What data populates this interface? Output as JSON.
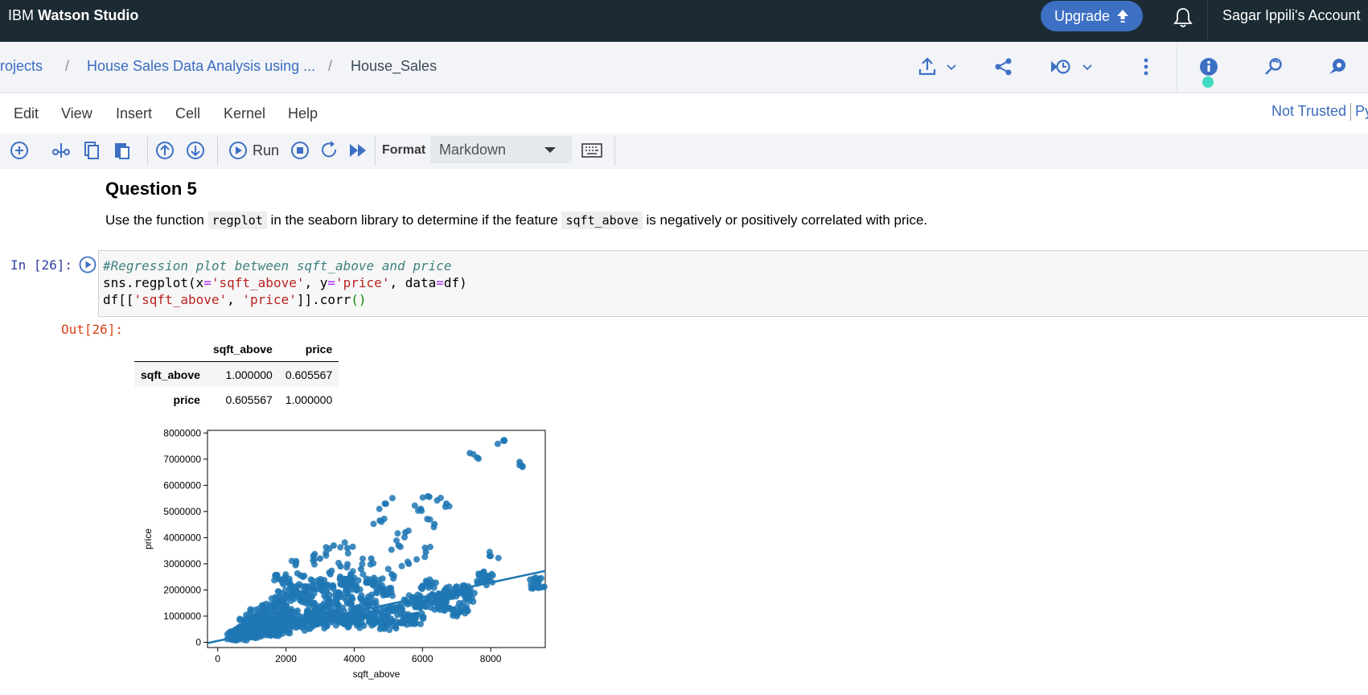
{
  "header": {
    "brand_prefix": "IBM",
    "brand_name": "Watson Studio",
    "upgrade_label": "Upgrade",
    "account_label": "Sagar Ippili's Account"
  },
  "breadcrumb": {
    "projects": "rojects",
    "project": "House Sales Data Analysis using ...",
    "notebook": "House_Sales",
    "separator": "/"
  },
  "menu": {
    "items": [
      "Edit",
      "View",
      "Insert",
      "Cell",
      "Kernel",
      "Help"
    ],
    "trusted": "Not Trusted",
    "kernel_partial": "Py"
  },
  "toolbar": {
    "run_label": "Run",
    "format_label": "Format",
    "format_value": "Markdown"
  },
  "markdown_cell": {
    "title": "Question 5",
    "text_before": "Use the function",
    "code1": "regplot",
    "text_middle": "in the seaborn library to determine if the feature",
    "code2": "sqft_above",
    "text_after": "is negatively or positively correlated with price."
  },
  "code_cell": {
    "prompt": "In [26]:",
    "comment": "#Regression plot between sqft_above and price",
    "line2_a": "sns.regplot(x",
    "line2_b": "'sqft_above'",
    "line2_c": ", y",
    "line2_d": "'price'",
    "line2_e": ", data",
    "line2_f": "df)",
    "line3_a": "df[[",
    "line3_b": "'sqft_above'",
    "line3_c": ", ",
    "line3_d": "'price'",
    "line3_e": "]].corr",
    "line3_f": "()",
    "eq": "="
  },
  "output": {
    "prompt": "Out[26]:",
    "table": {
      "columns": [
        "sqft_above",
        "price"
      ],
      "rows": [
        {
          "index": "sqft_above",
          "values": [
            "1.000000",
            "0.605567"
          ]
        },
        {
          "index": "price",
          "values": [
            "0.605567",
            "1.000000"
          ]
        }
      ]
    }
  },
  "chart_data": {
    "type": "scatter",
    "xlabel": "sqft_above",
    "ylabel": "price",
    "xlim": [
      -300,
      9600
    ],
    "ylim": [
      -200000,
      8100000
    ],
    "xticks": [
      0,
      2000,
      4000,
      6000,
      8000
    ],
    "yticks": [
      0,
      1000000,
      2000000,
      3000000,
      4000000,
      5000000,
      6000000,
      7000000,
      8000000
    ],
    "ytick_labels": [
      "0",
      "1000000",
      "2000000",
      "3000000",
      "4000000",
      "5000000",
      "6000000",
      "7000000",
      "8000000"
    ],
    "color": "#1f77b4",
    "points": [
      [
        8400,
        7700000
      ],
      [
        7600,
        7060000
      ],
      [
        8850,
        6890000
      ],
      [
        4900,
        5300000
      ],
      [
        6200,
        5560000
      ],
      [
        6700,
        5300000
      ],
      [
        5950,
        5100000
      ],
      [
        6350,
        4520000
      ],
      [
        4750,
        4650000
      ],
      [
        5500,
        4200000
      ],
      [
        8000,
        3300000
      ],
      [
        7800,
        2700000
      ],
      [
        7850,
        2400000
      ],
      [
        9400,
        2280000
      ],
      [
        7200,
        1950000
      ],
      [
        6800,
        1900000
      ],
      [
        6500,
        1700000
      ],
      [
        7100,
        1150000
      ],
      [
        5300,
        3700000
      ],
      [
        6100,
        3450000
      ],
      [
        3400,
        3700000
      ],
      [
        3800,
        3600000
      ],
      [
        2300,
        3100000
      ],
      [
        2800,
        3300000
      ],
      [
        4500,
        3200000
      ],
      [
        5600,
        3000000
      ],
      [
        3000,
        3200000
      ],
      [
        4200,
        2800000
      ],
      [
        5100,
        2600000
      ],
      [
        6200,
        2200000
      ],
      [
        4600,
        2300000
      ],
      [
        3600,
        2900000
      ],
      [
        2500,
        2500000
      ],
      [
        4000,
        2200000
      ],
      [
        5700,
        1600000
      ],
      [
        6000,
        1500000
      ],
      [
        5200,
        1200000
      ],
      [
        4800,
        1100000
      ],
      [
        5500,
        900000
      ],
      [
        6400,
        1650000
      ],
      [
        2000,
        1800000
      ],
      [
        1800,
        1500000
      ],
      [
        2600,
        1700000
      ],
      [
        3200,
        2000000
      ],
      [
        3700,
        1700000
      ],
      [
        1500,
        1300000
      ],
      [
        1200,
        1100000
      ],
      [
        1000,
        900000
      ],
      [
        800,
        700000
      ],
      [
        1300,
        650000
      ],
      [
        1700,
        900000
      ],
      [
        2100,
        1200000
      ],
      [
        2400,
        1000000
      ],
      [
        2900,
        1300000
      ],
      [
        3300,
        1500000
      ],
      [
        3500,
        1100000
      ],
      [
        4100,
        1300000
      ],
      [
        4400,
        1600000
      ],
      [
        700,
        400000
      ],
      [
        900,
        500000
      ],
      [
        1100,
        450000
      ],
      [
        1400,
        600000
      ],
      [
        1600,
        550000
      ],
      [
        1900,
        700000
      ],
      [
        2200,
        800000
      ],
      [
        2700,
        900000
      ],
      [
        3100,
        1000000
      ],
      [
        3900,
        900000
      ],
      [
        4300,
        1000000
      ],
      [
        4700,
        800000
      ],
      [
        600,
        300000
      ],
      [
        500,
        250000
      ],
      [
        1050,
        350000
      ],
      [
        1250,
        400000
      ],
      [
        1550,
        450000
      ],
      [
        2050,
        550000
      ],
      [
        2550,
        650000
      ],
      [
        3050,
        750000
      ],
      [
        3550,
        850000
      ],
      [
        4050,
        750000
      ],
      [
        5000,
        700000
      ],
      [
        5800,
        900000
      ],
      [
        6600,
        1400000
      ],
      [
        7300,
        1700000
      ],
      [
        1900,
        2400000
      ],
      [
        2300,
        2000000
      ],
      [
        2800,
        2200000
      ],
      [
        3300,
        2600000
      ],
      [
        3800,
        2400000
      ],
      [
        4900,
        1900000
      ]
    ],
    "regression_line": {
      "x": [
        -300,
        9600
      ],
      "y": [
        -30000,
        2730000
      ]
    }
  }
}
